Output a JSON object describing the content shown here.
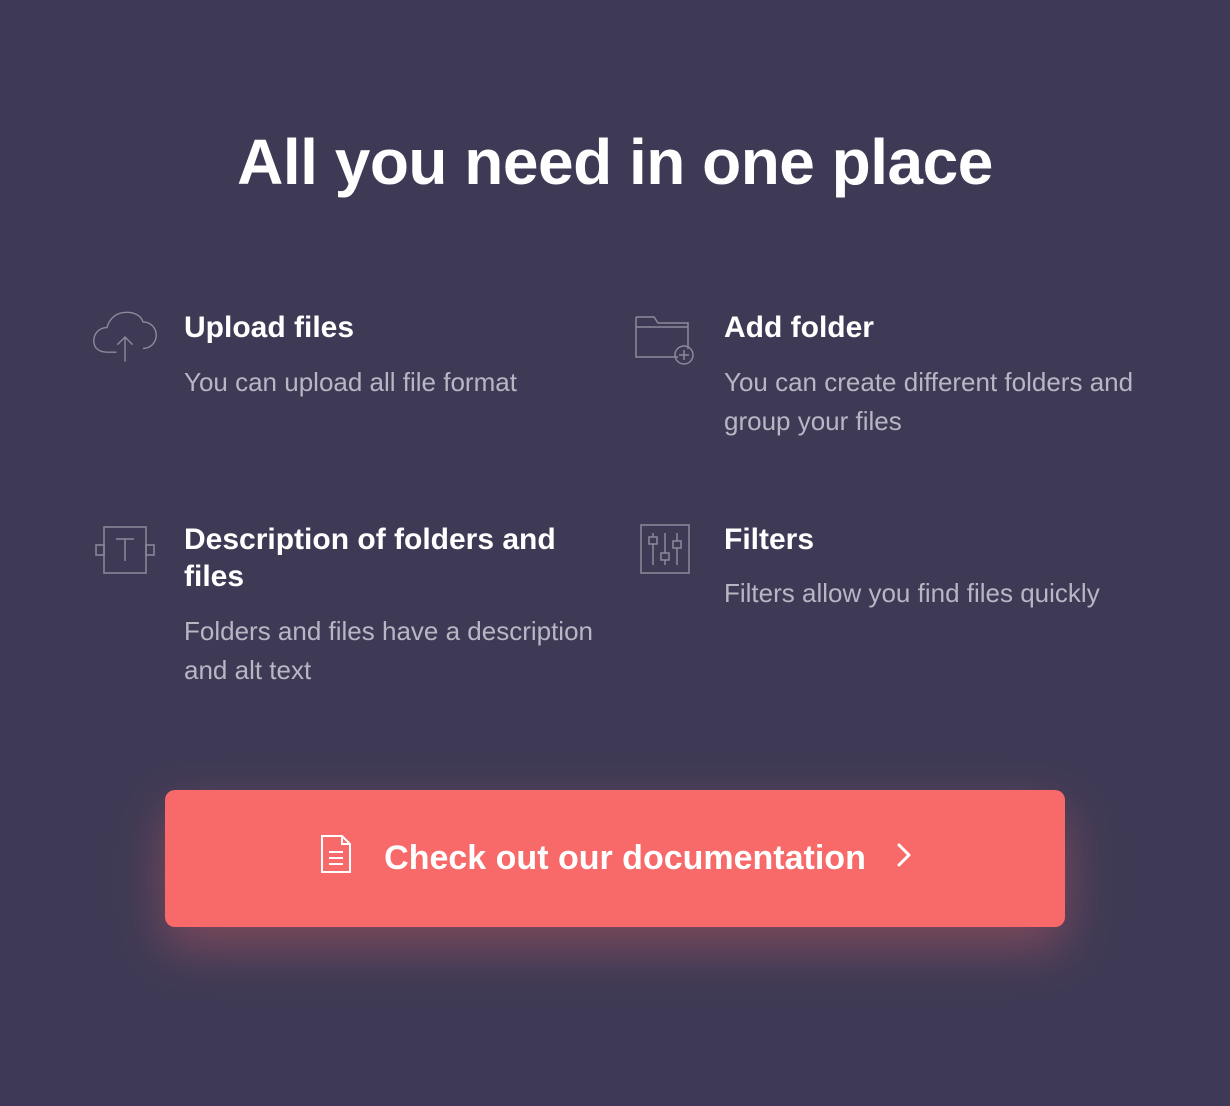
{
  "title": "All you need in one place",
  "features": [
    {
      "title": "Upload files",
      "description": "You can upload all file format"
    },
    {
      "title": "Add folder",
      "description": "You can create different folders and group your files"
    },
    {
      "title": "Description of folders and files",
      "description": "Folders and files have a description and alt text"
    },
    {
      "title": "Filters",
      "description": "Filters allow you find files quickly"
    }
  ],
  "cta": {
    "label": "Check out our documentation"
  }
}
